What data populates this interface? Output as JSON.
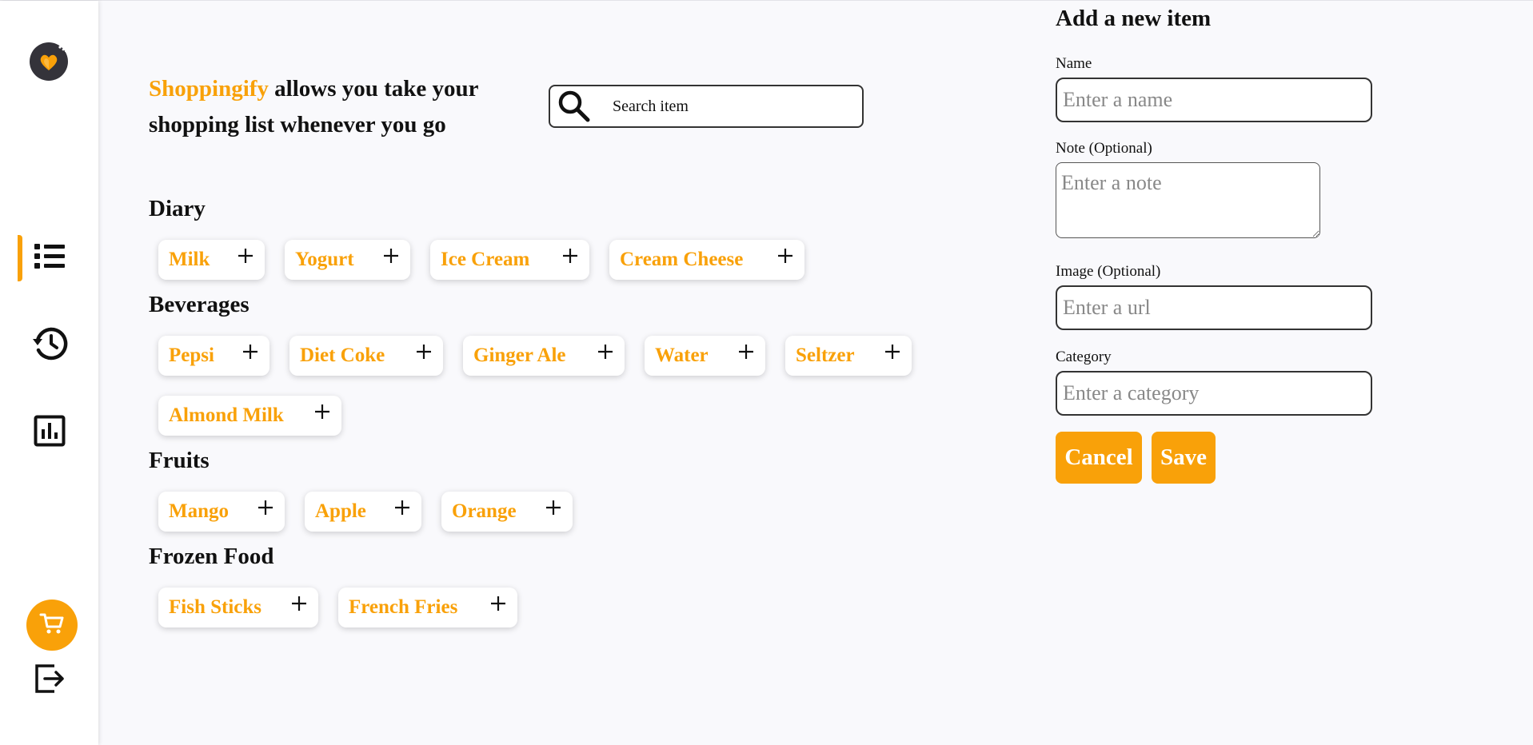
{
  "brand": {
    "name": "Shoppingify",
    "tagline": " allows you take your shopping list whenever you go"
  },
  "search": {
    "placeholder": "Search item"
  },
  "sidebar": {
    "items": [
      {
        "name": "items-nav",
        "icon": "list-icon",
        "active": true
      },
      {
        "name": "history-nav",
        "icon": "history-icon",
        "active": false
      },
      {
        "name": "statistics-nav",
        "icon": "chart-icon",
        "active": false
      }
    ],
    "cart_icon": "shopping-cart-icon",
    "logout_icon": "logout-icon"
  },
  "categories": [
    {
      "title": "Diary",
      "items": [
        "Milk",
        "Yogurt",
        "Ice Cream",
        "Cream Cheese"
      ]
    },
    {
      "title": "Beverages",
      "items": [
        "Pepsi",
        "Diet Coke",
        "Ginger Ale",
        "Water",
        "Seltzer",
        "Almond Milk"
      ]
    },
    {
      "title": "Fruits",
      "items": [
        "Mango",
        "Apple",
        "Orange"
      ]
    },
    {
      "title": "Frozen Food",
      "items": [
        "Fish Sticks",
        "French Fries"
      ]
    }
  ],
  "form": {
    "title": "Add a new item",
    "name_label": "Name",
    "name_placeholder": "Enter a name",
    "note_label": "Note (Optional)",
    "note_placeholder": "Enter a note",
    "image_label": "Image (Optional)",
    "image_placeholder": "Enter a url",
    "category_label": "Category",
    "category_placeholder": "Enter a category",
    "cancel_label": "Cancel",
    "save_label": "Save"
  },
  "colors": {
    "accent": "#f9a109",
    "logo_dark": "#34333a"
  }
}
